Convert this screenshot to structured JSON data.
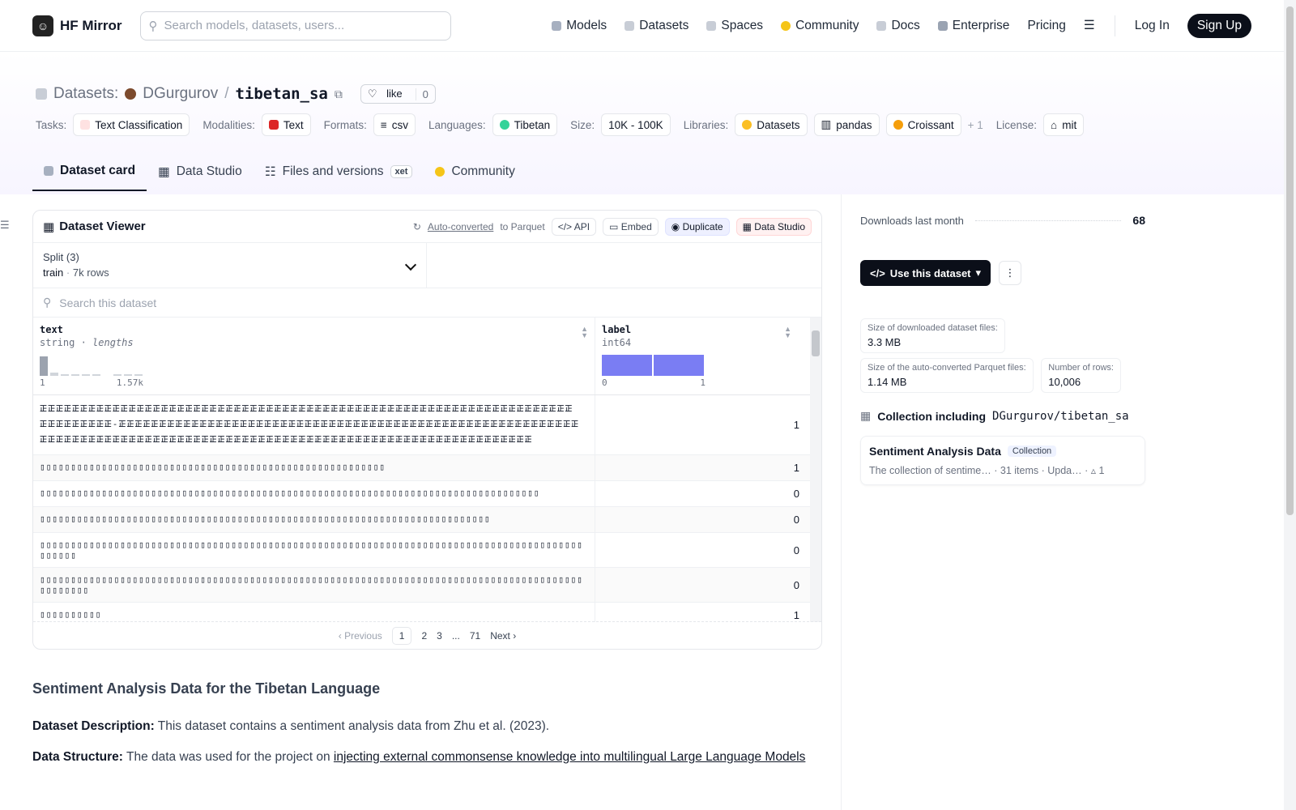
{
  "app": {
    "brand": "HF Mirror"
  },
  "header": {
    "search_placeholder": "Search models, datasets, users...",
    "nav": [
      "Models",
      "Datasets",
      "Spaces",
      "Community",
      "Docs",
      "Enterprise",
      "Pricing"
    ],
    "login": "Log In",
    "signup": "Sign Up"
  },
  "dataset": {
    "section": "Datasets:",
    "owner": "DGurgurov",
    "name": "tibetan_sa",
    "like_label": "like",
    "like_count": "0",
    "tags": {
      "tasks_label": "Tasks:",
      "tasks": "Text Classification",
      "modalities_label": "Modalities:",
      "modalities": "Text",
      "formats_label": "Formats:",
      "formats": "csv",
      "languages_label": "Languages:",
      "languages": "Tibetan",
      "size_label": "Size:",
      "size": "10K - 100K",
      "libraries_label": "Libraries:",
      "libraries": [
        "Datasets",
        "pandas",
        "Croissant"
      ],
      "libraries_more": "+ 1",
      "license_label": "License:",
      "license": "mit"
    },
    "tabs": [
      "Dataset card",
      "Data Studio",
      "Files and versions",
      "Community"
    ],
    "xet_badge": "xet"
  },
  "viewer": {
    "title": "Dataset Viewer",
    "auto_converted": "Auto-converted",
    "to_parquet": "to Parquet",
    "api": "API",
    "embed": "Embed",
    "duplicate": "Duplicate",
    "data_studio": "Data Studio",
    "split_label": "Split (3)",
    "split_value": "train",
    "split_rows": "7k rows",
    "search_placeholder": "Search this dataset",
    "columns": [
      {
        "name": "text",
        "type": "string",
        "extra": "lengths",
        "min": "1",
        "max": "1.57k"
      },
      {
        "name": "label",
        "type": "int64",
        "min": "0",
        "max": "1"
      }
    ],
    "rows": [
      {
        "text": "𝍶𝍶𝍶𝍶𝍶𝍶𝍶𝍶𝍶𝍶𝍶𝍶𝍶𝍶𝍶𝍶𝍶𝍶𝍶𝍶𝍶𝍶𝍶𝍶𝍶𝍶𝍶𝍶𝍶𝍶𝍶𝍶𝍶𝍶𝍶𝍶𝍶𝍶𝍶𝍶𝍶𝍶𝍶𝍶𝍶𝍶𝍶𝍶𝍶𝍶𝍶𝍶𝍶𝍶𝍶𝍶𝍶𝍶𝍶𝍶𝍶𝍶𝍶𝍶𝍶𝍶𝍶𝍶𝍶𝍶𝍶𝍶𝍶𝍶𝍶-𝍶𝍶𝍶𝍶𝍶𝍶𝍶𝍶𝍶𝍶𝍶𝍶𝍶𝍶𝍶𝍶𝍶𝍶𝍶𝍶𝍶𝍶𝍶𝍶𝍶𝍶𝍶𝍶𝍶𝍶𝍶𝍶𝍶𝍶𝍶𝍶𝍶𝍶𝍶𝍶𝍶𝍶𝍶𝍶𝍶𝍶𝍶𝍶𝍶𝍶𝍶𝍶𝍶𝍶𝍶𝍶𝍶𝍶𝍶𝍶𝍶𝍶𝍶𝍶𝍶𝍶𝍶𝍶𝍶𝍶𝍶𝍶𝍶𝍶𝍶𝍶𝍶𝍶𝍶𝍶𝍶𝍶𝍶𝍶𝍶𝍶𝍶𝍶𝍶𝍶𝍶𝍶𝍶𝍶𝍶𝍶𝍶𝍶𝍶𝍶𝍶𝍶𝍶𝍶𝍶𝍶𝍶𝍶𝍶𝍶𝍶𝍶𝍶𝍶𝍶𝍶𝍶𝍶",
        "label": "1"
      },
      {
        "text": "▯▯▯▯▯▯▯▯▯▯▯▯▯▯▯▯▯▯▯▯▯▯▯▯▯▯▯▯▯▯▯▯▯▯▯▯▯▯▯▯▯▯▯▯▯▯▯▯▯▯▯▯▯▯▯▯",
        "label": "1"
      },
      {
        "text": "▯▯▯▯▯▯▯▯▯▯▯▯▯▯▯▯▯▯▯▯▯▯▯▯▯▯▯▯▯▯▯▯▯▯▯▯▯▯▯▯▯▯▯▯▯▯▯▯▯▯▯▯▯▯▯▯▯▯▯▯▯▯▯▯▯▯▯▯▯▯▯▯▯▯▯▯▯▯▯▯▯",
        "label": "0"
      },
      {
        "text": "▯▯▯▯▯▯▯▯▯▯▯▯▯▯▯▯▯▯▯▯▯▯▯▯▯▯▯▯▯▯▯▯▯▯▯▯▯▯▯▯▯▯▯▯▯▯▯▯▯▯▯▯▯▯▯▯▯▯▯▯▯▯▯▯▯▯▯▯▯▯▯▯▯",
        "label": "0"
      },
      {
        "text": "▯▯▯▯▯▯▯▯▯▯▯▯▯▯▯▯▯▯▯▯▯▯▯▯▯▯▯▯▯▯▯▯▯▯▯▯▯▯▯▯▯▯▯▯▯▯▯▯▯▯▯▯▯▯▯▯▯▯▯▯▯▯▯▯▯▯▯▯▯▯▯▯▯▯▯▯▯▯▯▯▯▯▯▯▯▯▯▯▯▯▯▯▯▯",
        "label": "0"
      },
      {
        "text": "▯▯▯▯▯▯▯▯▯▯▯▯▯▯▯▯▯▯▯▯▯▯▯▯▯▯▯▯▯▯▯▯▯▯▯▯▯▯▯▯▯▯▯▯▯▯▯▯▯▯▯▯▯▯▯▯▯▯▯▯▯▯▯▯▯▯▯▯▯▯▯▯▯▯▯▯▯▯▯▯▯▯▯▯▯▯▯▯▯▯▯▯▯▯▯▯",
        "label": "0"
      },
      {
        "text": "▯▯▯▯▯▯▯▯▯▯",
        "label": "1"
      }
    ],
    "pager": {
      "prev": "Previous",
      "pages": [
        "1",
        "2",
        "3",
        "...",
        "71"
      ],
      "next": "Next"
    }
  },
  "sidebar": {
    "downloads_label": "Downloads last month",
    "downloads": "68",
    "use_button": "Use this dataset",
    "stats": [
      {
        "k": "Size of downloaded dataset files:",
        "v": "3.3 MB"
      },
      {
        "k": "Size of the auto-converted Parquet files:",
        "v": "1.14 MB"
      },
      {
        "k": "Number of rows:",
        "v": "10,006"
      }
    ],
    "collection_heading": "Collection including",
    "collection_repo": "DGurgurov/tibetan_sa",
    "card": {
      "title": "Sentiment Analysis Data",
      "badge": "Collection",
      "desc": "The collection of sentime…",
      "items": "31 items",
      "updated": "Upda…",
      "upvotes": "1"
    }
  },
  "content": {
    "heading": "Sentiment Analysis Data for the Tibetan Language",
    "desc_label": "Dataset Description:",
    "desc_text": " This dataset contains a sentiment analysis data from Zhu et al. (2023).",
    "struct_label": "Data Structure:",
    "struct_text": " The data was used for the project on ",
    "struct_link": "injecting external commonsense knowledge into multilingual Large Language Models"
  }
}
